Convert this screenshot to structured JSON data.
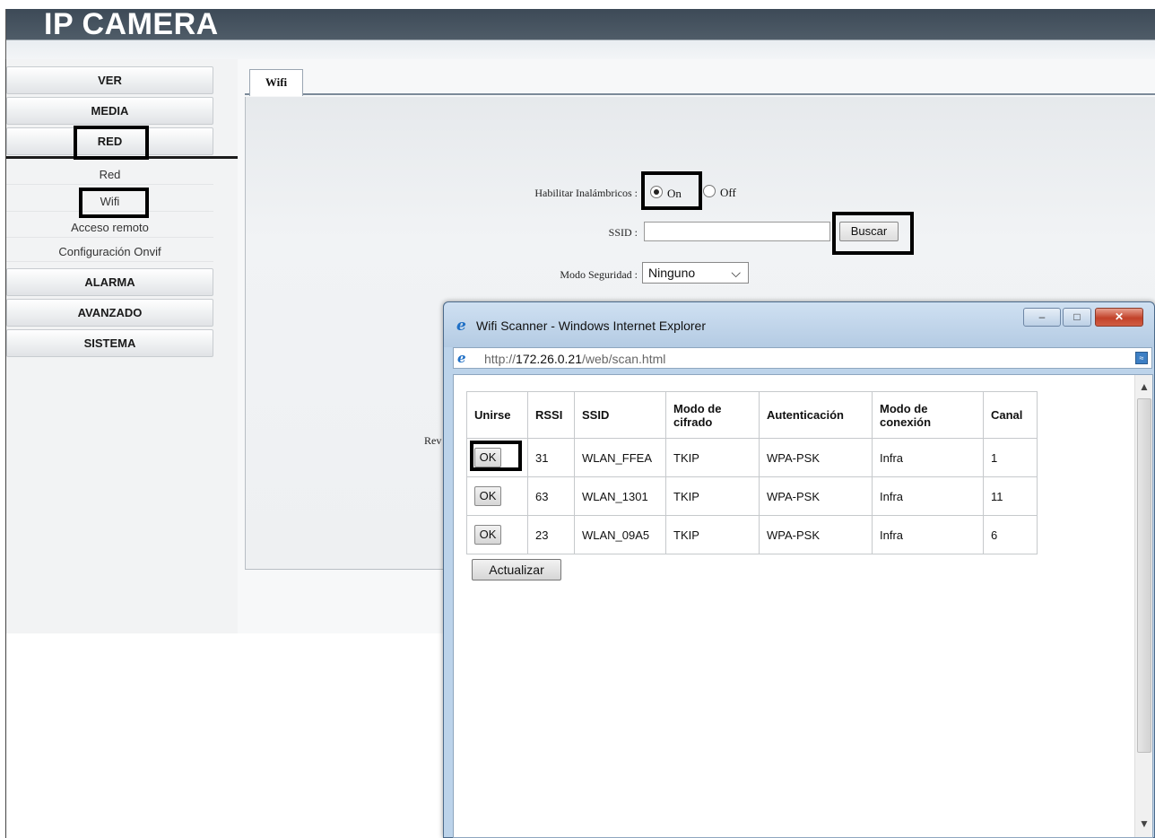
{
  "header": {
    "title": "IP CAMERA"
  },
  "sidebar": {
    "menu": [
      {
        "label": "VER"
      },
      {
        "label": "MEDIA"
      },
      {
        "label": "RED"
      },
      {
        "label": "ALARMA"
      },
      {
        "label": "AVANZADO"
      },
      {
        "label": "SISTEMA"
      }
    ],
    "red_submenu": [
      {
        "label": "Red"
      },
      {
        "label": "Wifi"
      },
      {
        "label": "Acceso remoto"
      },
      {
        "label": "Configuración Onvif"
      }
    ]
  },
  "main": {
    "tab_label": "Wifi",
    "form": {
      "enable_label": "Habilitar Inalámbricos :",
      "enable_on": "On",
      "enable_off": "Off",
      "enable_selected": "On",
      "ssid_label": "SSID :",
      "ssid_value": "",
      "search_button": "Buscar",
      "security_label": "Modo Seguridad :",
      "security_value": "Ninguno",
      "partial_label": "Rev"
    }
  },
  "popup": {
    "title": "Wifi Scanner - Windows Internet Explorer",
    "url_prefix": "http://",
    "url_host": "172.26.0.21",
    "url_path": "/web/scan.html",
    "table": {
      "headers": [
        "Unirse",
        "RSSI",
        "SSID",
        "Modo de cifrado",
        "Autenticación",
        "Modo de conexión",
        "Canal"
      ],
      "rows": [
        {
          "join": "OK",
          "rssi": "31",
          "ssid": "WLAN_FFEA",
          "cipher": "TKIP",
          "auth": "WPA-PSK",
          "mode": "Infra",
          "channel": "1"
        },
        {
          "join": "OK",
          "rssi": "63",
          "ssid": "WLAN_1301",
          "cipher": "TKIP",
          "auth": "WPA-PSK",
          "mode": "Infra",
          "channel": "11"
        },
        {
          "join": "OK",
          "rssi": "23",
          "ssid": "WLAN_09A5",
          "cipher": "TKIP",
          "auth": "WPA-PSK",
          "mode": "Infra",
          "channel": "6"
        }
      ]
    },
    "refresh_button": "Actualizar"
  },
  "icons": {
    "browser": "ie-icon",
    "minimize": "minimize-icon",
    "maximize": "maximize-icon",
    "close": "close-icon",
    "chevron": "chevron-down-icon"
  },
  "colors": {
    "header_dark": "#3d4a57",
    "highlight_border": "#000000",
    "popup_frame": "#bcd3ea",
    "close_button": "#c2422a"
  }
}
